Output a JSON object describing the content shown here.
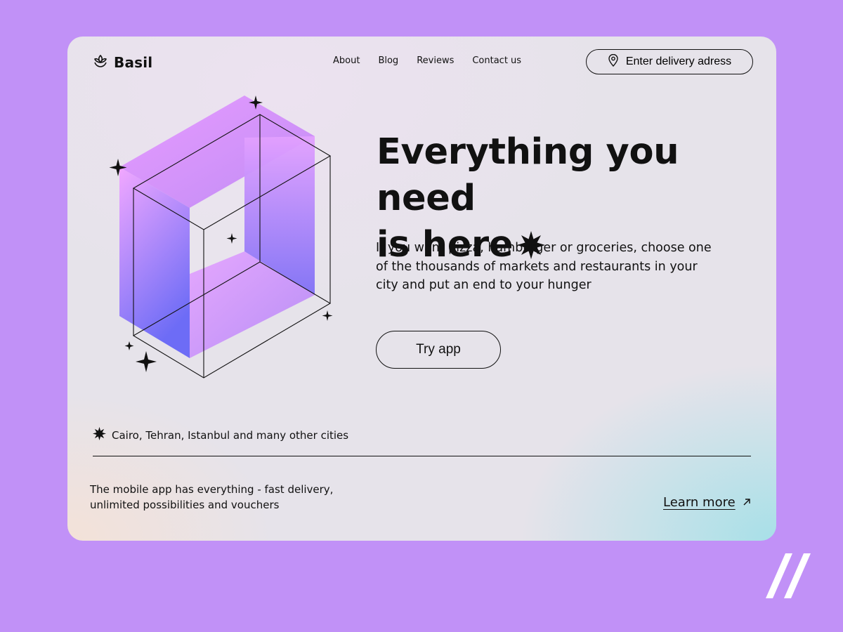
{
  "brand": {
    "name": "Basil",
    "logo_icon": "leaf-logo-icon"
  },
  "nav": {
    "items": [
      {
        "label": "About"
      },
      {
        "label": "Blog"
      },
      {
        "label": "Reviews"
      },
      {
        "label": "Contact us"
      }
    ]
  },
  "delivery": {
    "label": "Enter delivery adress",
    "icon": "location-pin-icon"
  },
  "hero": {
    "headline_line1": "Everything you need",
    "headline_line2": "is here",
    "description": "If you want pizza, hamburger or groceries, choose one of the thousands of markets and restaurants in your city and put an end to your hunger",
    "cta_label": "Try app"
  },
  "cities": {
    "text": "Cairo, Tehran, Istanbul and many other cities",
    "icon": "starburst-icon"
  },
  "footer": {
    "text": "The mobile app has everything - fast delivery, unlimited possibilities and vouchers",
    "learn_more": "Learn more",
    "arrow_icon": "arrow-up-right-icon"
  },
  "colors": {
    "background": "#c191f7",
    "card": "#e6e3ea",
    "gradient_pink": "#f0a6ff",
    "gradient_blue": "#6e6cf5",
    "text": "#111111"
  }
}
